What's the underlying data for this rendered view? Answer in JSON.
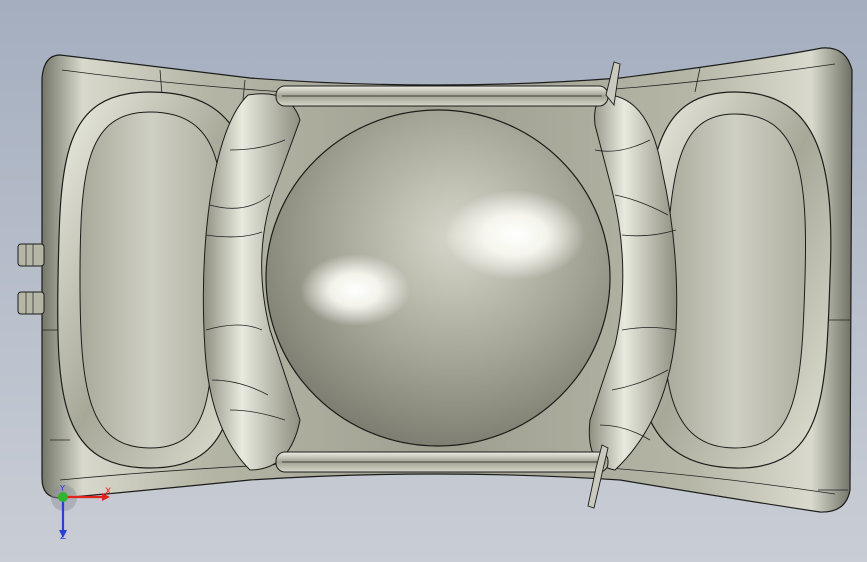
{
  "viewport": {
    "background_top": "#a4aebf",
    "background_bottom": "#c9cdd5",
    "model_colors": {
      "base": "#b9baaa",
      "highlight": "#f4f4ea",
      "shadow": "#66675c",
      "edge": "#1c1c1a"
    }
  },
  "triad": {
    "x_label": "X",
    "y_label": "Y",
    "z_label": "Z",
    "x_color": "#e0241c",
    "y_color": "#2fb52f",
    "z_color": "#2a3fd6"
  }
}
